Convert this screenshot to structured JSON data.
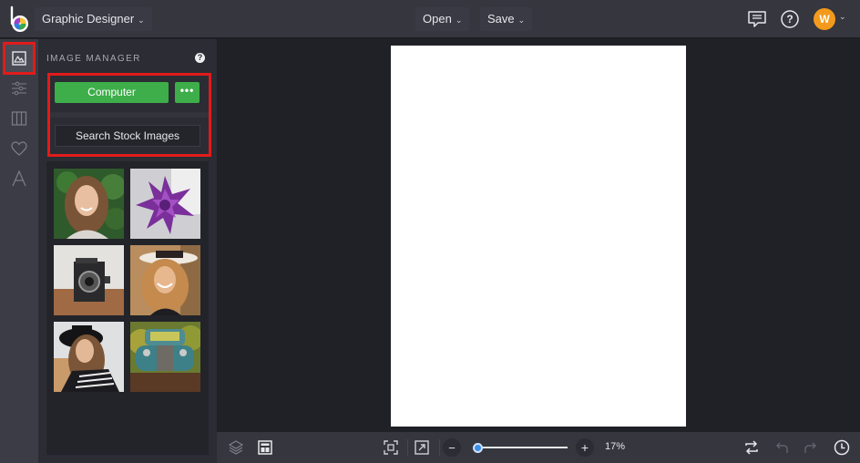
{
  "topbar": {
    "logo_icon": "befunky-logo-icon",
    "app_selector": "Graphic Designer",
    "menus": [
      {
        "label": "Open"
      },
      {
        "label": "Save"
      }
    ],
    "icons": [
      "chat-icon",
      "help-icon"
    ],
    "avatar_initial": "W"
  },
  "rail": {
    "items": [
      {
        "name": "image-manager",
        "icon": "image-icon",
        "active": true
      },
      {
        "name": "adjust",
        "icon": "sliders-icon",
        "active": false
      },
      {
        "name": "layouts",
        "icon": "columns-icon",
        "active": false
      },
      {
        "name": "graphics",
        "icon": "heart-icon",
        "active": false
      },
      {
        "name": "text",
        "icon": "text-icon",
        "active": false
      }
    ]
  },
  "panel": {
    "title": "IMAGE MANAGER",
    "help": "?",
    "computer_button": "Computer",
    "more_button": "•••",
    "stock_button": "Search Stock Images",
    "thumbnails": [
      {
        "subject": "smiling woman with long hair"
      },
      {
        "subject": "purple succulent flower"
      },
      {
        "subject": "vintage camera"
      },
      {
        "subject": "laughing woman in hat"
      },
      {
        "subject": "woman in black hat"
      },
      {
        "subject": "vintage blue truck"
      }
    ]
  },
  "bottombar": {
    "left_icons": [
      "layers-icon",
      "layout-icon"
    ],
    "center_icons": [
      "fit-screen-icon",
      "expand-icon"
    ],
    "zoom": {
      "minus": "−",
      "plus": "+",
      "value_percent": 17,
      "label": "17%"
    },
    "right_icons": [
      "swap-icon",
      "undo-icon",
      "redo-icon",
      "history-icon"
    ]
  },
  "colors": {
    "accent_green": "#3dae49",
    "highlight_red": "#e21b1b",
    "avatar_orange": "#f39a1c",
    "slider_blue": "#3a8fe8"
  }
}
